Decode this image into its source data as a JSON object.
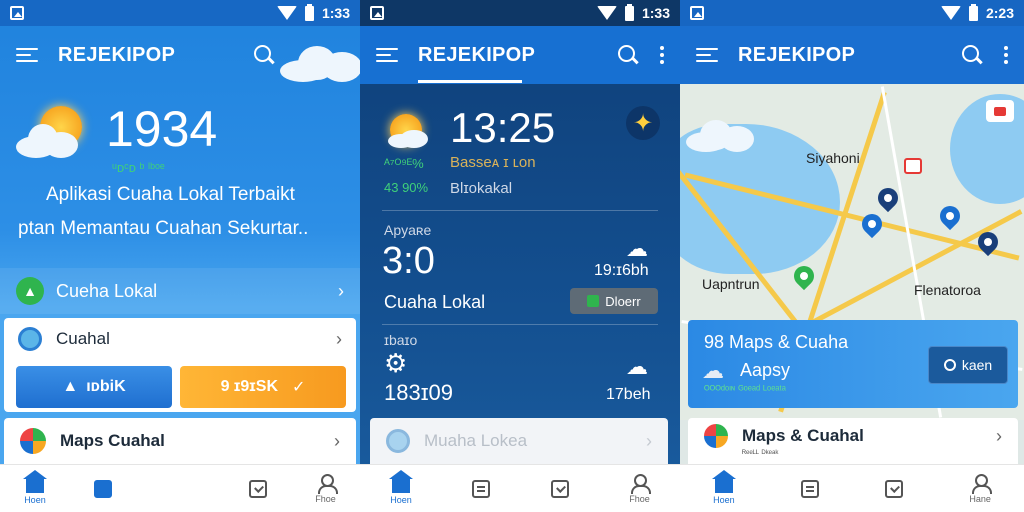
{
  "status": {
    "screen1_time": "1:33",
    "screen2_time": "1:33",
    "screen3_time": "2:23"
  },
  "screen1": {
    "app_title": "REJEKIPOP",
    "time": "1934",
    "sub": "ᵘᴅᶜᴅ ᵇ ˡᵇᵒᵉ",
    "tagline_1": "Aplikasi Cuaha Lokal Terbaikt",
    "tagline_2": "ptan Memantau Cuahan Sekurtar..",
    "items": [
      {
        "label": "Cueha Lokal"
      },
      {
        "label": "Cuahal"
      },
      {
        "label": "Maps Cuahal"
      }
    ],
    "btn_left": "ıᴅbiK",
    "btn_right": "9 ɪ9ɪSK",
    "colors": {
      "accent_blue": "#1a6fd0",
      "accent_orange": "#f7a722",
      "green": "#2fb44e"
    }
  },
  "screen2": {
    "app_title": "REJEKIPOP",
    "time": "13:25",
    "row1_left": "ᴬ⁷ᴼ⁹ᴱ%",
    "row1_right": "Basseᴀ ɪ ʟon",
    "row2_left": "43 90%",
    "row2_right": "Blɪokakal",
    "section1_label": "Apyaʀe",
    "section1_value": "3:0",
    "section1_sub": "Cuaha Lokal",
    "section1_right": "19:ɪ6bh",
    "section1_btn": "Dloerr",
    "section2_label": "ɪbaɪo",
    "section2_value": "183ɪ09",
    "section2_right": "17beh",
    "card_label": "Muaha Lokea"
  },
  "screen3": {
    "app_title": "REJEKIPOP",
    "map_labels": [
      "Siyahoni",
      "Uapntrun",
      "Flenatoroa"
    ],
    "card_title": "98 Maps & Cuaha",
    "card_sub": "Aapsy",
    "card_green": "ᴼᴼᴼᵈᵒᶦᶰ ᴳᵒᵉᵃᵈ ᴸᵒᵉᵃᵗᵃ",
    "card_btn": "kaen",
    "list_title": "Maps & Cuahal",
    "list_sub": "ᴿᵉᵉᴸᴸ ᴰᵏᵉᵃᵏ"
  },
  "nav": {
    "s1": [
      "Hoen",
      "",
      "",
      "Fhoe"
    ],
    "s2": [
      "Hoen",
      "",
      "",
      "Fhoe"
    ],
    "s3": [
      "Hoen",
      "",
      "",
      "Hane"
    ]
  }
}
